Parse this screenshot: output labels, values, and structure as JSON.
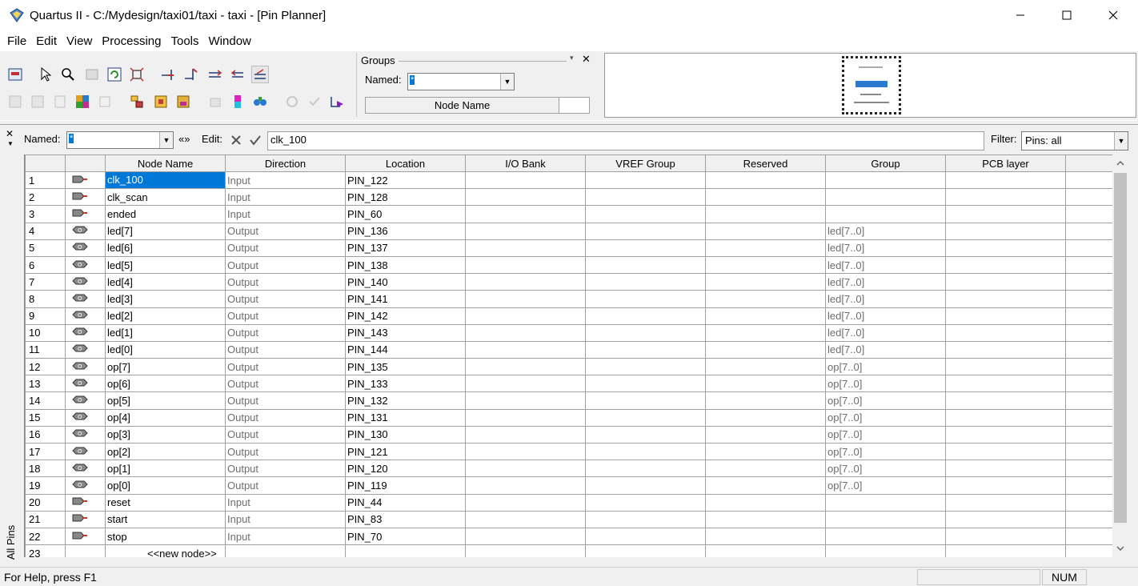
{
  "window": {
    "title": "Quartus II - C:/Mydesign/taxi01/taxi - taxi - [Pin Planner]",
    "minimize": "─",
    "maximize": "☐",
    "close": "✕"
  },
  "menu": [
    "File",
    "Edit",
    "View",
    "Processing",
    "Tools",
    "Window"
  ],
  "groups_panel": {
    "title": "Groups",
    "named_label": "Named:",
    "named_value": "*",
    "column": "Node Name"
  },
  "filter_bar": {
    "named_label": "Named:",
    "named_value": "*",
    "expand_symbol": "«»",
    "edit_label": "Edit:",
    "edit_value": "clk_100",
    "filter_label": "Filter:",
    "filter_value": "Pins: all"
  },
  "side_tab": "All Pins",
  "table": {
    "columns": [
      "Node Name",
      "Direction",
      "Location",
      "I/O Bank",
      "VREF Group",
      "Reserved",
      "Group",
      "PCB layer"
    ],
    "rows": [
      {
        "n": "1",
        "name": "clk_100",
        "dir": "Input",
        "loc": "PIN_122",
        "group": ""
      },
      {
        "n": "2",
        "name": "clk_scan",
        "dir": "Input",
        "loc": "PIN_128",
        "group": ""
      },
      {
        "n": "3",
        "name": "ended",
        "dir": "Input",
        "loc": "PIN_60",
        "group": ""
      },
      {
        "n": "4",
        "name": "led[7]",
        "dir": "Output",
        "loc": "PIN_136",
        "group": "led[7..0]"
      },
      {
        "n": "5",
        "name": "led[6]",
        "dir": "Output",
        "loc": "PIN_137",
        "group": "led[7..0]"
      },
      {
        "n": "6",
        "name": "led[5]",
        "dir": "Output",
        "loc": "PIN_138",
        "group": "led[7..0]"
      },
      {
        "n": "7",
        "name": "led[4]",
        "dir": "Output",
        "loc": "PIN_140",
        "group": "led[7..0]"
      },
      {
        "n": "8",
        "name": "led[3]",
        "dir": "Output",
        "loc": "PIN_141",
        "group": "led[7..0]"
      },
      {
        "n": "9",
        "name": "led[2]",
        "dir": "Output",
        "loc": "PIN_142",
        "group": "led[7..0]"
      },
      {
        "n": "10",
        "name": "led[1]",
        "dir": "Output",
        "loc": "PIN_143",
        "group": "led[7..0]"
      },
      {
        "n": "11",
        "name": "led[0]",
        "dir": "Output",
        "loc": "PIN_144",
        "group": "led[7..0]"
      },
      {
        "n": "12",
        "name": "op[7]",
        "dir": "Output",
        "loc": "PIN_135",
        "group": "op[7..0]"
      },
      {
        "n": "13",
        "name": "op[6]",
        "dir": "Output",
        "loc": "PIN_133",
        "group": "op[7..0]"
      },
      {
        "n": "14",
        "name": "op[5]",
        "dir": "Output",
        "loc": "PIN_132",
        "group": "op[7..0]"
      },
      {
        "n": "15",
        "name": "op[4]",
        "dir": "Output",
        "loc": "PIN_131",
        "group": "op[7..0]"
      },
      {
        "n": "16",
        "name": "op[3]",
        "dir": "Output",
        "loc": "PIN_130",
        "group": "op[7..0]"
      },
      {
        "n": "17",
        "name": "op[2]",
        "dir": "Output",
        "loc": "PIN_121",
        "group": "op[7..0]"
      },
      {
        "n": "18",
        "name": "op[1]",
        "dir": "Output",
        "loc": "PIN_120",
        "group": "op[7..0]"
      },
      {
        "n": "19",
        "name": "op[0]",
        "dir": "Output",
        "loc": "PIN_119",
        "group": "op[7..0]"
      },
      {
        "n": "20",
        "name": "reset",
        "dir": "Input",
        "loc": "PIN_44",
        "group": ""
      },
      {
        "n": "21",
        "name": "start",
        "dir": "Input",
        "loc": "PIN_83",
        "group": ""
      },
      {
        "n": "22",
        "name": "stop",
        "dir": "Input",
        "loc": "PIN_70",
        "group": ""
      },
      {
        "n": "23",
        "name": "<<new node>>",
        "dir": "",
        "loc": "",
        "group": ""
      }
    ]
  },
  "status": {
    "help": "For Help, press F1",
    "num": "NUM"
  },
  "colors": {
    "selection": "#0078d7",
    "grid_line": "#a0a0a0",
    "input_icon": "#c0392b"
  }
}
